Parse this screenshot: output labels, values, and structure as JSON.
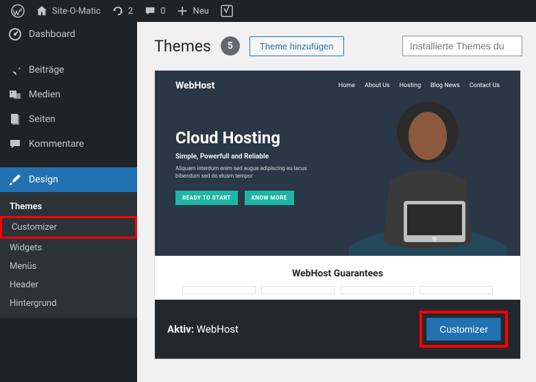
{
  "adminbar": {
    "site_name": "Site-O-Matic",
    "updates": "2",
    "comments": "0",
    "new_label": "Neu"
  },
  "sidebar": {
    "items": [
      {
        "label": "Dashboard"
      },
      {
        "label": "Beiträge"
      },
      {
        "label": "Medien"
      },
      {
        "label": "Seiten"
      },
      {
        "label": "Kommentare"
      },
      {
        "label": "Design"
      }
    ],
    "submenu": [
      {
        "label": "Themes"
      },
      {
        "label": "Customizer"
      },
      {
        "label": "Widgets"
      },
      {
        "label": "Menüs"
      },
      {
        "label": "Header"
      },
      {
        "label": "Hintergrund"
      }
    ]
  },
  "page": {
    "title": "Themes",
    "count": "5",
    "add_button": "Theme hinzufügen",
    "search_placeholder": "Installierte Themes du"
  },
  "theme": {
    "preview": {
      "logo": "WebHost",
      "nav": [
        "Home",
        "About Us",
        "Hosting",
        "Blog News",
        "Contact Us"
      ],
      "headline": "Cloud Hosting",
      "subhead": "Simple, Powerfull and Reliable",
      "desc": "Aliquam interdum enim sed augue adipiscing eu lacus bibendum sed do elusm tempor",
      "btn1": "READY TO START",
      "btn2": "KNOW MORE",
      "lower_title": "WebHost Guarantees"
    },
    "footer": {
      "active_label": "Aktiv:",
      "theme_name": "WebHost",
      "customize_button": "Customizer"
    }
  }
}
